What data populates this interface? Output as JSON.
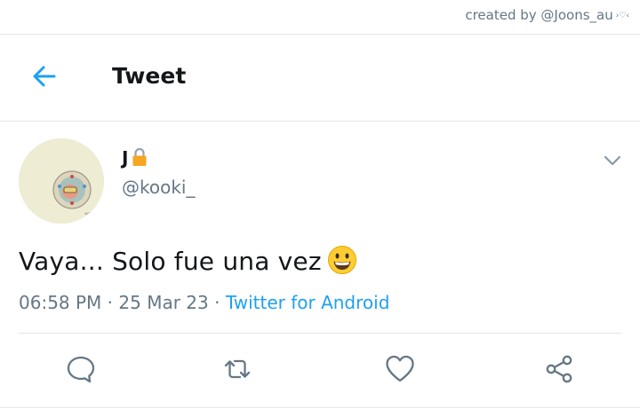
{
  "credit": {
    "text": "created by @Joons_au",
    "decoration": "›♡‹"
  },
  "header": {
    "title": "Tweet",
    "back_icon": "arrow-left-icon"
  },
  "tweet": {
    "display_name": "J",
    "protected_icon": "lock-icon",
    "handle": "@kooki_",
    "text": "Vaya... Solo fue una vez",
    "emoji": "grinning-face-emoji",
    "time": "06:58 PM",
    "date": "25 Mar 23",
    "separator": "·",
    "source": "Twitter for Android"
  },
  "actions": [
    {
      "name": "reply",
      "icon": "reply-icon"
    },
    {
      "name": "retweet",
      "icon": "retweet-icon"
    },
    {
      "name": "like",
      "icon": "heart-icon"
    },
    {
      "name": "share",
      "icon": "share-icon"
    }
  ],
  "colors": {
    "accent": "#1da1f2",
    "muted": "#657786",
    "divider": "#e1e8ed",
    "icon": "#657786",
    "lock": "#f5a623",
    "emoji": "#ffcc33"
  }
}
